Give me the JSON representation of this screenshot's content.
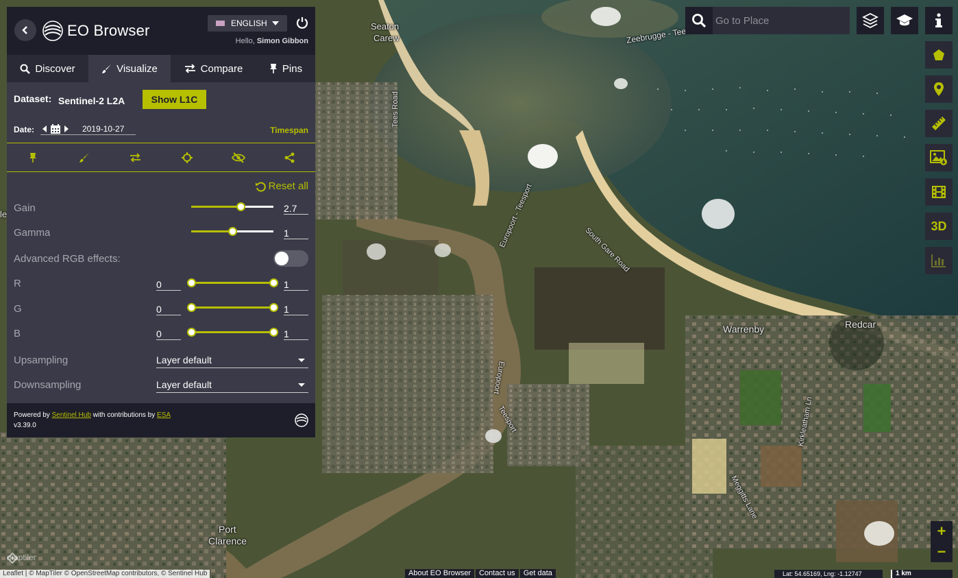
{
  "app": {
    "title": "EO Browser",
    "language": "ENGLISH",
    "greeting_prefix": "Hello, ",
    "user_name": "Simon Gibbon"
  },
  "tabs": [
    {
      "label": "Discover",
      "icon": "search-icon"
    },
    {
      "label": "Visualize",
      "icon": "brush-icon",
      "active": true
    },
    {
      "label": "Compare",
      "icon": "compare-icon"
    },
    {
      "label": "Pins",
      "icon": "pin-icon"
    }
  ],
  "dataset": {
    "label": "Dataset:",
    "value": "Sentinel-2 L2A",
    "toggle_button": "Show L1C"
  },
  "date": {
    "label": "Date:",
    "value": "2019-10-27",
    "timespan_label": "Timespan"
  },
  "toolbar_icons": [
    "pin-icon",
    "brush-icon",
    "compare-icon",
    "crosshair-icon",
    "hide-icon",
    "share-icon"
  ],
  "controls": {
    "reset_all": "Reset all",
    "gain": {
      "label": "Gain",
      "value": "2.7",
      "level": 0.6
    },
    "gamma": {
      "label": "Gamma",
      "value": "1",
      "level": 0.5
    },
    "advanced_rgb": {
      "label": "Advanced RGB effects:",
      "enabled": false
    },
    "r": {
      "label": "R",
      "min": "0",
      "max": "1"
    },
    "g": {
      "label": "G",
      "min": "0",
      "max": "1"
    },
    "b": {
      "label": "B",
      "min": "0",
      "max": "1"
    },
    "upsampling": {
      "label": "Upsampling",
      "value": "Layer default"
    },
    "downsampling": {
      "label": "Downsampling",
      "value": "Layer default"
    }
  },
  "footer": {
    "powered_by": "Powered by ",
    "sentinel_hub": "Sentinel Hub",
    "contributions": " with contributions by ",
    "esa": "ESA",
    "version": "v3.39.0"
  },
  "search": {
    "placeholder": "Go to Place"
  },
  "right_toolbar": [
    "polygon-icon",
    "location-pin-icon",
    "ruler-icon",
    "image-download-icon",
    "film-icon",
    "3D",
    "chart-icon"
  ],
  "top_buttons": [
    "layers-icon",
    "education-icon",
    "info-icon"
  ],
  "map": {
    "labels": {
      "seaton_carew_1": "Seaton",
      "seaton_carew_2": "Carew",
      "zeebrugge": "Zeebrugge - Tees",
      "tees_road": "Tees Road",
      "europoort_1": "Europoort - Teesport",
      "south_gare": "South Gare Road",
      "warrenby": "Warrenby",
      "redcar": "Redcar",
      "europoort_2": "Europoort",
      "teesport": "Teesport",
      "kirkleatham": "Kirkleatham Ln",
      "meggitts": "Meggitts Lane",
      "port_clarence_1": "Port",
      "port_clarence_2": "Clarence",
      "left_edge": "le"
    },
    "maptiler": "maptiler",
    "attribution": "Leaflet | © MapTiler © OpenStreetMap contributors, © Sentinel Hub",
    "links": [
      "About EO Browser",
      "Contact us",
      "Get data"
    ],
    "coords": "Lat: 54.65169, Lng: -1.12747",
    "scale": "1 km",
    "zoom_in": "+",
    "zoom_out": "−"
  }
}
